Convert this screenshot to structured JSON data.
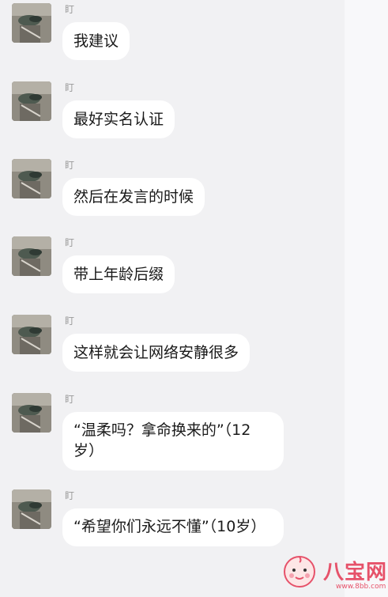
{
  "messages": [
    {
      "sender": "盯",
      "text": "我建议"
    },
    {
      "sender": "盯",
      "text": "最好实名认证"
    },
    {
      "sender": "盯",
      "text": "然后在发言的时候"
    },
    {
      "sender": "盯",
      "text": "带上年龄后缀"
    },
    {
      "sender": "盯",
      "text": "这样就会让网络安静很多"
    },
    {
      "sender": "盯",
      "text": "“温柔吗？拿命换来的”（12岁）"
    },
    {
      "sender": "盯",
      "text": "“希望你们永远不懂”（10岁）"
    }
  ],
  "watermark": {
    "brand": "八宝网",
    "url": "www.8bb.com"
  },
  "icons": {
    "avatar": "avatar-image",
    "watermark_logo": "baby-face-icon"
  },
  "colors": {
    "background": "#f1f1f3",
    "bubble": "#ffffff",
    "text": "#1a1a1a",
    "name": "#9a9a9a",
    "watermark": "#e6526a"
  }
}
